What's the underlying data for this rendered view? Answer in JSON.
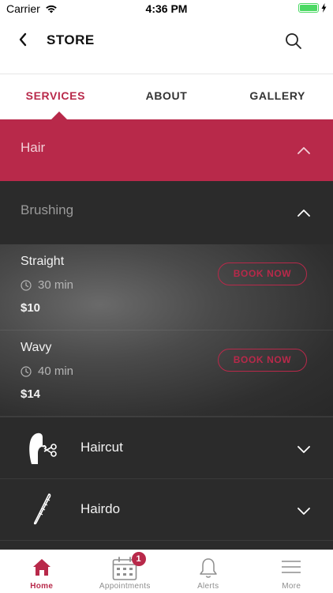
{
  "status_bar": {
    "carrier": "Carrier",
    "time": "4:36 PM"
  },
  "header": {
    "title": "STORE",
    "back_icon": "chevron-left-icon",
    "search_icon": "search-icon"
  },
  "tabs": [
    {
      "label": "SERVICES",
      "active": true
    },
    {
      "label": "ABOUT",
      "active": false
    },
    {
      "label": "GALLERY",
      "active": false
    }
  ],
  "category": {
    "label": "Hair",
    "state": "expanded"
  },
  "subcategory": {
    "label": "Brushing",
    "state": "expanded"
  },
  "services": [
    {
      "name": "Straight",
      "duration": "30 min",
      "price": "$10",
      "action": "BOOK NOW"
    },
    {
      "name": "Wavy",
      "duration": "40 min",
      "price": "$14",
      "action": "BOOK NOW"
    }
  ],
  "collapsed_categories": [
    {
      "label": "Haircut",
      "icon": "haircut-icon"
    },
    {
      "label": "Hairdo",
      "icon": "hairpin-icon"
    }
  ],
  "tabbar": [
    {
      "label": "Home",
      "icon": "home-icon",
      "active": true
    },
    {
      "label": "Appointments",
      "icon": "calendar-icon",
      "badge": "1"
    },
    {
      "label": "Alerts",
      "icon": "bell-icon"
    },
    {
      "label": "More",
      "icon": "menu-icon"
    }
  ],
  "colors": {
    "accent": "#b8294a",
    "dark": "#2b2b2b"
  }
}
